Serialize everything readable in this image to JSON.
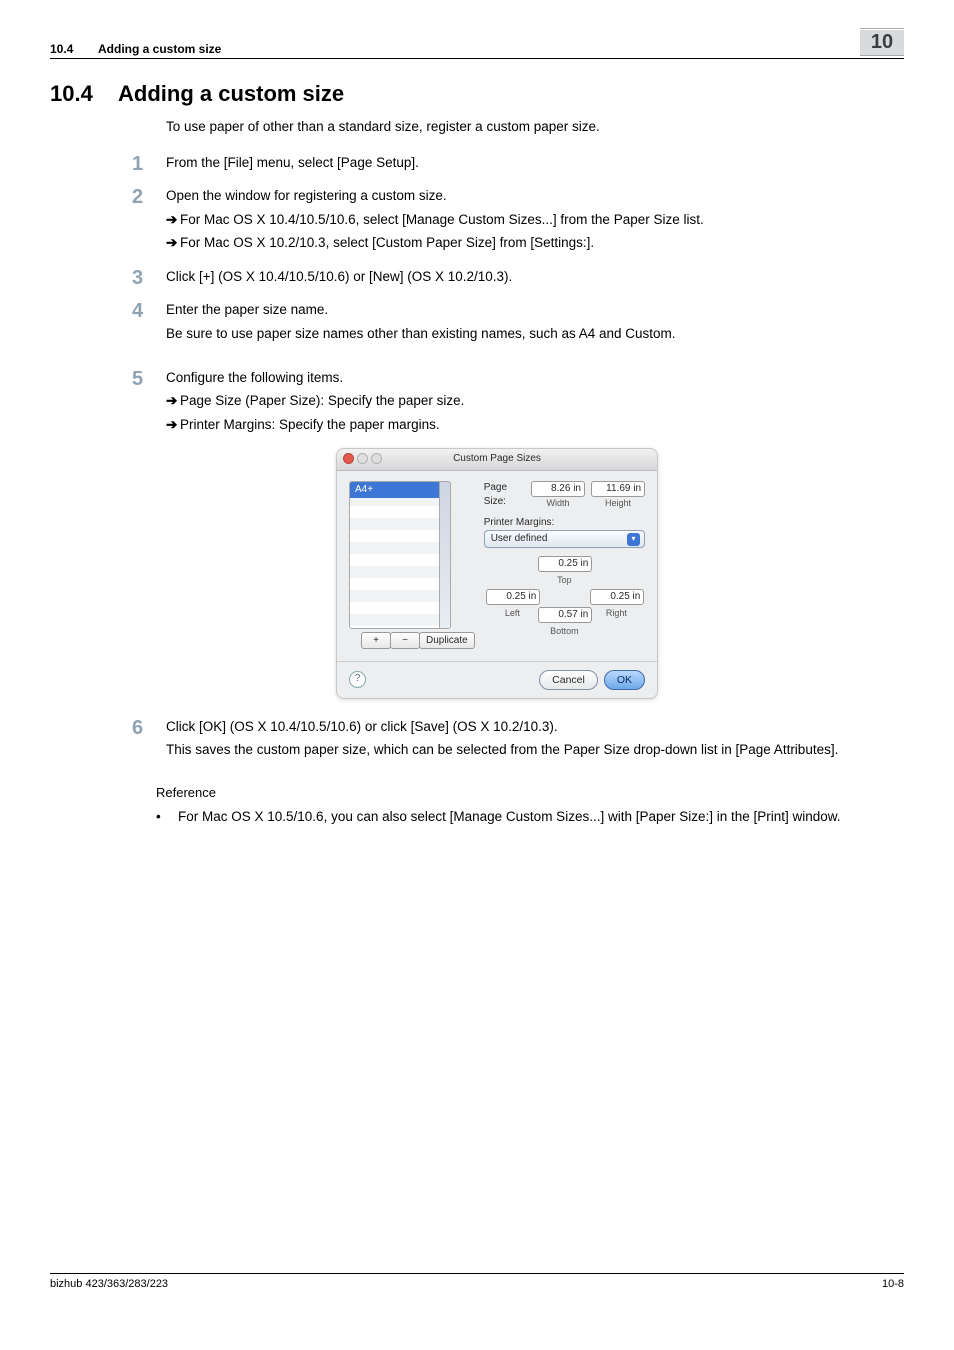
{
  "header": {
    "section_num": "10.4",
    "section_title": "Adding a custom size",
    "chapter": "10"
  },
  "title": {
    "num": "10.4",
    "text": "Adding a custom size"
  },
  "intro": "To use paper of other than a standard size, register a custom paper size.",
  "steps": {
    "s1": {
      "num": "1",
      "text": "From the [File] menu, select [Page Setup]."
    },
    "s2": {
      "num": "2",
      "text": "Open the window for registering a custom size.",
      "sub1": "For Mac OS X 10.4/10.5/10.6, select [Manage Custom Sizes...] from the Paper Size list.",
      "sub2": "For Mac OS X 10.2/10.3, select [Custom Paper Size] from [Settings:]."
    },
    "s3": {
      "num": "3",
      "text": "Click [+] (OS X 10.4/10.5/10.6) or [New] (OS X 10.2/10.3)."
    },
    "s4": {
      "num": "4",
      "text": "Enter the paper size name.",
      "note": "Be sure to use paper size names other than existing names, such as A4 and Custom."
    },
    "s5": {
      "num": "5",
      "text": "Configure the following items.",
      "sub1": "Page Size (Paper Size): Specify the paper size.",
      "sub2": "Printer Margins: Specify the paper margins."
    },
    "s6": {
      "num": "6",
      "text": "Click [OK] (OS X 10.4/10.5/10.6) or click [Save] (OS X 10.2/10.3).",
      "note": "This saves the custom paper size, which can be selected from the Paper Size drop-down list in [Page Attributes]."
    }
  },
  "reference": {
    "heading": "Reference",
    "bullet": "For Mac OS X 10.5/10.6, you can also select [Manage Custom Sizes...] with [Paper Size:] in the [Print] window."
  },
  "screenshot": {
    "window_title": "Custom Page Sizes",
    "selected_item": "A4+",
    "page_size_label": "Page Size:",
    "width_val": "8.26 in",
    "width_lab": "Width",
    "height_val": "11.69 in",
    "height_lab": "Height",
    "margins_label": "Printer Margins:",
    "margins_select": "User defined",
    "top_val": "0.25 in",
    "top_lab": "Top",
    "left_val": "0.25 in",
    "left_lab": "Left",
    "right_val": "0.25 in",
    "right_lab": "Right",
    "bottom_val": "0.57 in",
    "bottom_lab": "Bottom",
    "btn_plus": "+",
    "btn_minus": "−",
    "btn_dup": "Duplicate",
    "btn_cancel": "Cancel",
    "btn_ok": "OK",
    "help": "?"
  },
  "footer": {
    "left": "bizhub 423/363/283/223",
    "right": "10-8"
  },
  "glyphs": {
    "arrow": "➔",
    "bullet": "•",
    "chev": "▾"
  }
}
